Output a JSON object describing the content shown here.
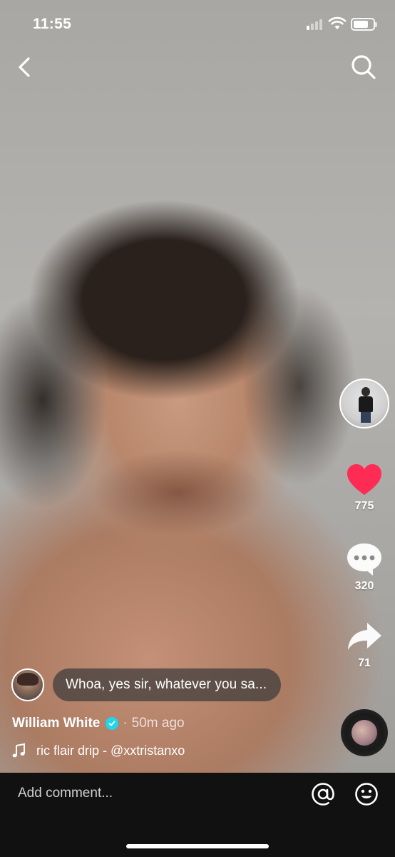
{
  "status_bar": {
    "time": "11:55",
    "signal_bars_active": 1,
    "battery_level": 0.75
  },
  "nav": {
    "back_icon": "chevron-left-icon",
    "search_icon": "search-icon"
  },
  "right_rail": {
    "creator_avatar_icon": "avatar",
    "like": {
      "icon": "heart-icon",
      "count": "775",
      "color": "#fe2c55"
    },
    "comment": {
      "icon": "comment-bubble-icon",
      "count": "320"
    },
    "share": {
      "icon": "share-arrow-icon",
      "count": "71"
    },
    "music_disc_icon": "music-disc-icon"
  },
  "featured_comment": {
    "text": "Whoa, yes sir, whatever you sa..."
  },
  "video_meta": {
    "author": "William White",
    "verified": true,
    "separator": "·",
    "time_ago": "50m ago",
    "music": "ric flair drip - @xxtristanxo"
  },
  "bottom_bar": {
    "placeholder": "Add comment...",
    "mention_icon": "at-icon",
    "emoji_icon": "emoji-icon"
  },
  "colors": {
    "verified_badge": "#20d5ec",
    "bottom_bar": "#111111"
  }
}
